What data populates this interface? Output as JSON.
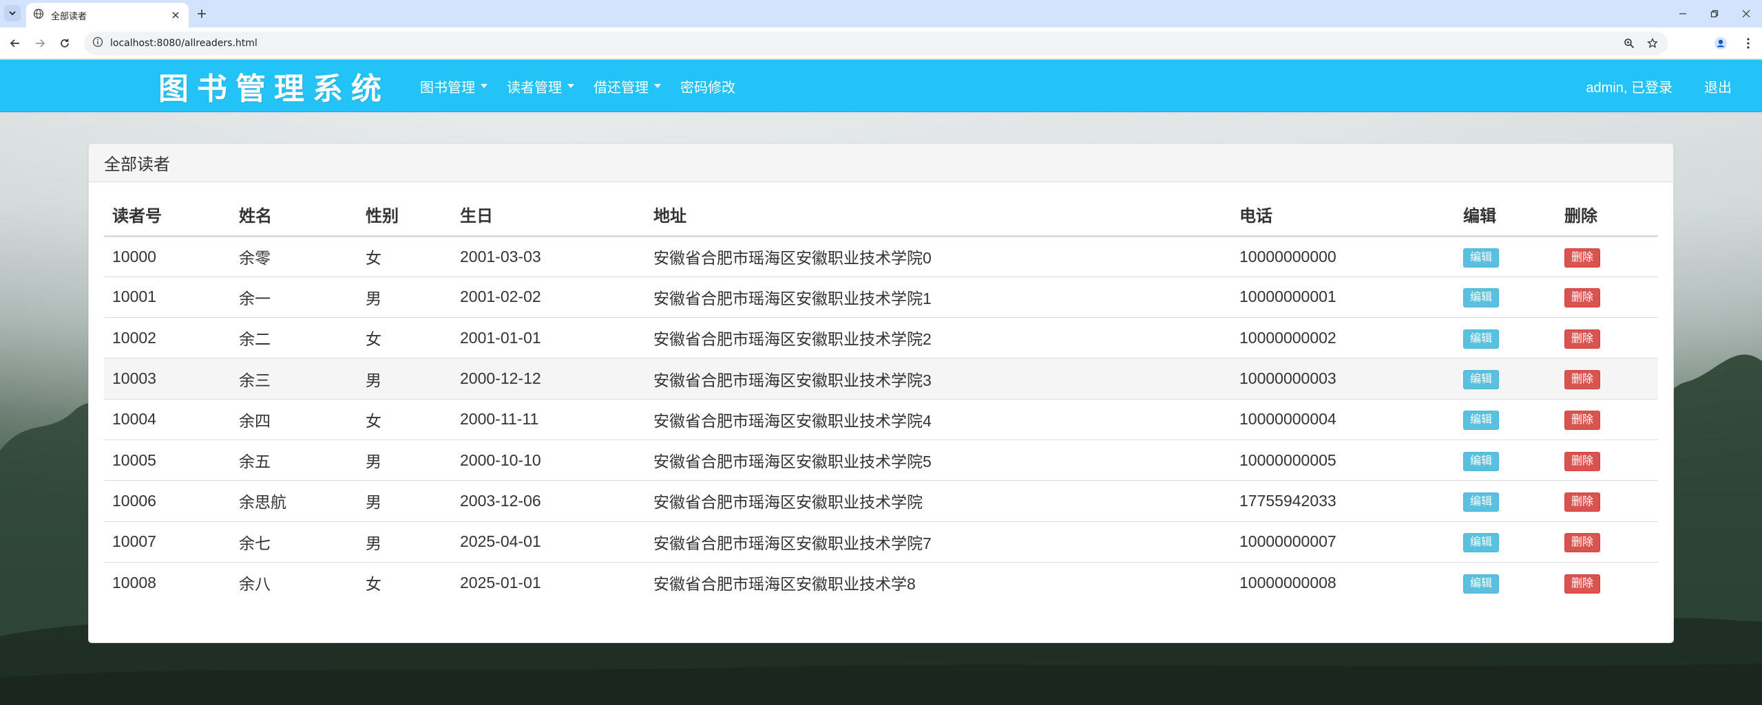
{
  "browser": {
    "tab_title": "全部读者",
    "url": "localhost:8080/allreaders.html"
  },
  "navbar": {
    "brand": "图书管理系统",
    "menu": [
      {
        "label": "图书管理",
        "dropdown": true
      },
      {
        "label": "读者管理",
        "dropdown": true
      },
      {
        "label": "借还管理",
        "dropdown": true
      },
      {
        "label": "密码修改",
        "dropdown": false
      }
    ],
    "user_status": "admin, 已登录",
    "logout": "退出"
  },
  "panel": {
    "title": "全部读者"
  },
  "table": {
    "columns": [
      "读者号",
      "姓名",
      "性别",
      "生日",
      "地址",
      "电话",
      "编辑",
      "删除"
    ],
    "edit_label": "编辑",
    "delete_label": "删除",
    "rows": [
      {
        "id": "10000",
        "name": "余零",
        "sex": "女",
        "birth": "2001-03-03",
        "address": "安徽省合肥市瑶海区安徽职业技术学院0",
        "phone": "10000000000"
      },
      {
        "id": "10001",
        "name": "余一",
        "sex": "男",
        "birth": "2001-02-02",
        "address": "安徽省合肥市瑶海区安徽职业技术学院1",
        "phone": "10000000001"
      },
      {
        "id": "10002",
        "name": "余二",
        "sex": "女",
        "birth": "2001-01-01",
        "address": "安徽省合肥市瑶海区安徽职业技术学院2",
        "phone": "10000000002"
      },
      {
        "id": "10003",
        "name": "余三",
        "sex": "男",
        "birth": "2000-12-12",
        "address": "安徽省合肥市瑶海区安徽职业技术学院3",
        "phone": "10000000003"
      },
      {
        "id": "10004",
        "name": "余四",
        "sex": "女",
        "birth": "2000-11-11",
        "address": "安徽省合肥市瑶海区安徽职业技术学院4",
        "phone": "10000000004"
      },
      {
        "id": "10005",
        "name": "余五",
        "sex": "男",
        "birth": "2000-10-10",
        "address": "安徽省合肥市瑶海区安徽职业技术学院5",
        "phone": "10000000005"
      },
      {
        "id": "10006",
        "name": "余思航",
        "sex": "男",
        "birth": "2003-12-06",
        "address": "安徽省合肥市瑶海区安徽职业技术学院",
        "phone": "17755942033"
      },
      {
        "id": "10007",
        "name": "余七",
        "sex": "男",
        "birth": "2025-04-01",
        "address": "安徽省合肥市瑶海区安徽职业技术学院7",
        "phone": "10000000007"
      },
      {
        "id": "10008",
        "name": "余八",
        "sex": "女",
        "birth": "2025-01-01",
        "address": "安徽省合肥市瑶海区安徽职业技术学8",
        "phone": "10000000008"
      }
    ]
  },
  "colors": {
    "navbar": "#24c3f7",
    "edit_button": "#5bc0de",
    "delete_button": "#d9534f"
  }
}
